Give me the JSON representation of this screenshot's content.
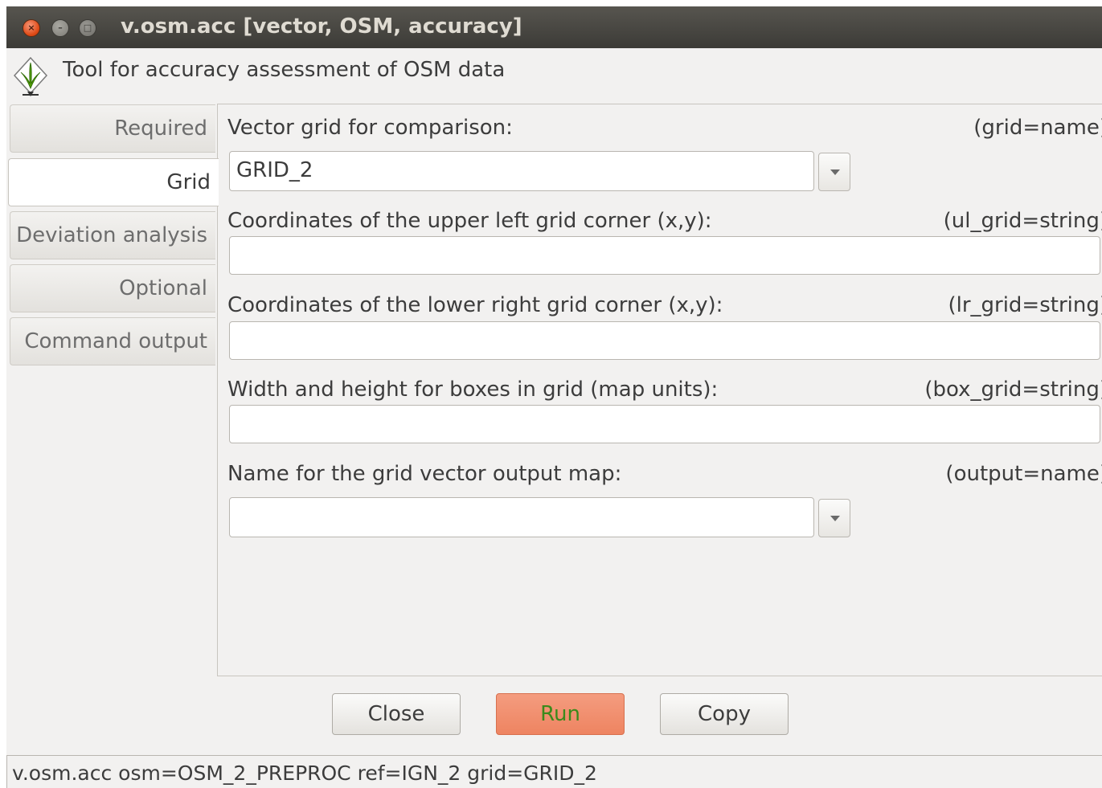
{
  "window": {
    "title": "v.osm.acc [vector, OSM, accuracy]",
    "close_glyph": "×",
    "minimize_glyph": "–",
    "maximize_glyph": "□"
  },
  "header": {
    "description": "Tool for accuracy assessment of OSM data",
    "icon": "grass-gis-icon"
  },
  "tabs": [
    {
      "label": "Required",
      "active": false
    },
    {
      "label": "Grid",
      "active": true
    },
    {
      "label": "Deviation analysis",
      "active": false
    },
    {
      "label": "Optional",
      "active": false
    },
    {
      "label": "Command output",
      "active": false
    }
  ],
  "grid": {
    "grid_label": "Vector grid for comparison:",
    "grid_key": "(grid=name)",
    "grid_value": "GRID_2",
    "ul_label": "Coordinates of the upper left grid corner (x,y):",
    "ul_key": "(ul_grid=string)",
    "ul_value": "",
    "lr_label": "Coordinates of the lower right grid corner (x,y):",
    "lr_key": "(lr_grid=string)",
    "lr_value": "",
    "box_label": "Width and height for boxes in grid (map units):",
    "box_key": "(box_grid=string)",
    "box_value": "",
    "output_label": "Name for the grid vector output map:",
    "output_key": "(output=name)",
    "output_value": ""
  },
  "buttons": {
    "close": "Close",
    "run": "Run",
    "copy": "Copy"
  },
  "status": {
    "command": "v.osm.acc osm=OSM_2_PREPROC ref=IGN_2 grid=GRID_2"
  },
  "colors": {
    "titlebar": "#3c3b37",
    "run_button": "#ee8461",
    "run_text": "#3b8a1c",
    "close_button": "#df4a16"
  }
}
